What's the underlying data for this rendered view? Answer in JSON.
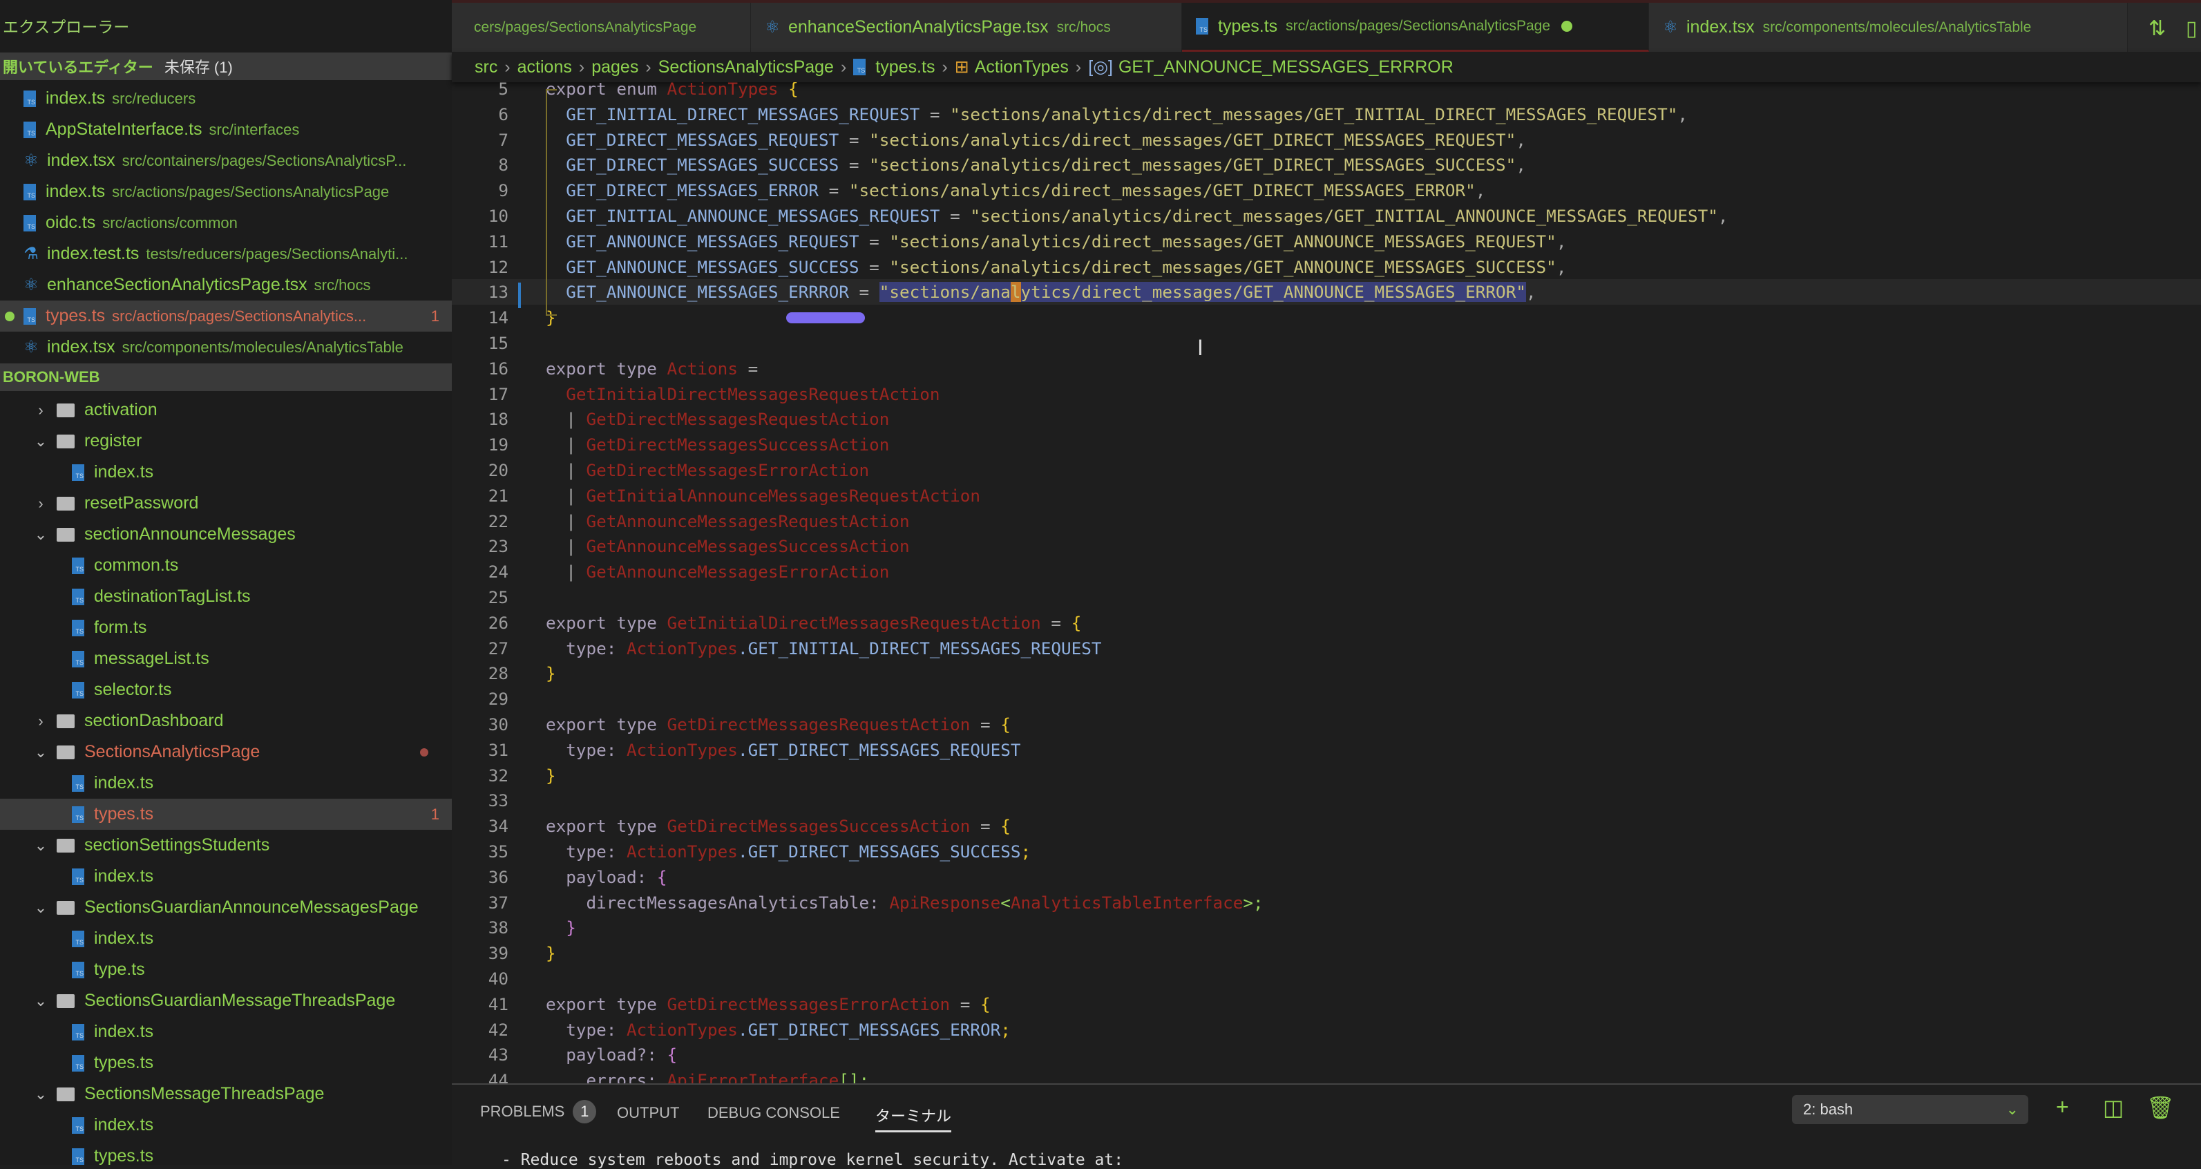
{
  "sidebar": {
    "title": "エクスプローラー",
    "open_editors": {
      "label": "開いているエディター",
      "unsaved": "未保存 (1)",
      "items": [
        {
          "name": "index.ts",
          "path": "src/reducers",
          "icon": "ts"
        },
        {
          "name": "AppStateInterface.ts",
          "path": "src/interfaces",
          "icon": "ts"
        },
        {
          "name": "index.tsx",
          "path": "src/containers/pages/SectionsAnalyticsP...",
          "icon": "react"
        },
        {
          "name": "index.ts",
          "path": "src/actions/pages/SectionsAnalyticsPage",
          "icon": "ts"
        },
        {
          "name": "oidc.ts",
          "path": "src/actions/common",
          "icon": "ts"
        },
        {
          "name": "index.test.ts",
          "path": "tests/reducers/pages/SectionsAnalyti...",
          "icon": "flask"
        },
        {
          "name": "enhanceSectionAnalyticsPage.tsx",
          "path": "src/hocs",
          "icon": "react"
        },
        {
          "name": "types.ts",
          "path": "src/actions/pages/SectionsAnalytics...",
          "icon": "ts",
          "badge": "1",
          "selected": true,
          "error": true,
          "unsaved": true
        },
        {
          "name": "index.tsx",
          "path": "src/components/molecules/AnalyticsTable",
          "icon": "react"
        }
      ]
    },
    "project": "BORON-WEB",
    "tree": [
      {
        "name": "activation",
        "type": "folder",
        "open": false
      },
      {
        "name": "register",
        "type": "folder",
        "open": true
      },
      {
        "name": "index.ts",
        "type": "file"
      },
      {
        "name": "resetPassword",
        "type": "folder",
        "open": false
      },
      {
        "name": "sectionAnnounceMessages",
        "type": "folder",
        "open": true
      },
      {
        "name": "common.ts",
        "type": "file"
      },
      {
        "name": "destinationTagList.ts",
        "type": "file"
      },
      {
        "name": "form.ts",
        "type": "file"
      },
      {
        "name": "messageList.ts",
        "type": "file"
      },
      {
        "name": "selector.ts",
        "type": "file"
      },
      {
        "name": "sectionDashboard",
        "type": "folder",
        "open": false
      },
      {
        "name": "SectionsAnalyticsPage",
        "type": "folder",
        "open": true,
        "error": true
      },
      {
        "name": "index.ts",
        "type": "file"
      },
      {
        "name": "types.ts",
        "type": "file",
        "selected": true,
        "error": true,
        "badge": "1"
      },
      {
        "name": "sectionSettingsStudents",
        "type": "folder",
        "open": true
      },
      {
        "name": "index.ts",
        "type": "file"
      },
      {
        "name": "SectionsGuardianAnnounceMessagesPage",
        "type": "folder",
        "open": true
      },
      {
        "name": "index.ts",
        "type": "file"
      },
      {
        "name": "type.ts",
        "type": "file"
      },
      {
        "name": "SectionsGuardianMessageThreadsPage",
        "type": "folder",
        "open": true
      },
      {
        "name": "index.ts",
        "type": "file"
      },
      {
        "name": "types.ts",
        "type": "file"
      },
      {
        "name": "SectionsMessageThreadsPage",
        "type": "folder",
        "open": true
      },
      {
        "name": "index.ts",
        "type": "file"
      },
      {
        "name": "types.ts",
        "type": "file"
      }
    ]
  },
  "tabs": [
    {
      "title": "",
      "desc": "cers/pages/SectionsAnalyticsPage",
      "icon": ""
    },
    {
      "title": "enhanceSectionAnalyticsPage.tsx",
      "desc": "src/hocs",
      "icon": "react"
    },
    {
      "title": "types.ts",
      "desc": "src/actions/pages/SectionsAnalyticsPage",
      "icon": "ts",
      "active": true,
      "dirty": true
    },
    {
      "title": "index.tsx",
      "desc": "src/components/molecules/AnalyticsTable",
      "icon": "react"
    }
  ],
  "breadcrumb": [
    "src",
    "actions",
    "pages",
    "SectionsAnalyticsPage",
    "types.ts",
    "ActionTypes",
    "GET_ANNOUNCE_MESSAGES_ERRROR"
  ],
  "editor": {
    "current_line": 13,
    "lines": [
      {
        "n": "5",
        "t": [
          [
            "export enum ",
            "kw"
          ],
          [
            "ActionTypes",
            "tn"
          ],
          [
            " {",
            "br"
          ]
        ]
      },
      {
        "n": "6",
        "t": [
          [
            "  GET_INITIAL_DIRECT_MESSAGES_REQUEST",
            "id"
          ],
          [
            " = ",
            "p"
          ],
          [
            "\"sections/analytics/direct_messages/GET_INITIAL_DIRECT_MESSAGES_REQUEST\"",
            "str"
          ],
          [
            ",",
            "p"
          ]
        ]
      },
      {
        "n": "7",
        "t": [
          [
            "  GET_DIRECT_MESSAGES_REQUEST",
            "id"
          ],
          [
            " = ",
            "p"
          ],
          [
            "\"sections/analytics/direct_messages/GET_DIRECT_MESSAGES_REQUEST\"",
            "str"
          ],
          [
            ",",
            "p"
          ]
        ]
      },
      {
        "n": "8",
        "t": [
          [
            "  GET_DIRECT_MESSAGES_SUCCESS",
            "id"
          ],
          [
            " = ",
            "p"
          ],
          [
            "\"sections/analytics/direct_messages/GET_DIRECT_MESSAGES_SUCCESS\"",
            "str"
          ],
          [
            ",",
            "p"
          ]
        ]
      },
      {
        "n": "9",
        "t": [
          [
            "  GET_DIRECT_MESSAGES_ERROR",
            "id"
          ],
          [
            " = ",
            "p"
          ],
          [
            "\"sections/analytics/direct_messages/GET_DIRECT_MESSAGES_ERROR\"",
            "str"
          ],
          [
            ",",
            "p"
          ]
        ]
      },
      {
        "n": "10",
        "t": [
          [
            "  GET_INITIAL_ANNOUNCE_MESSAGES_REQUEST",
            "id"
          ],
          [
            " = ",
            "p"
          ],
          [
            "\"sections/analytics/direct_messages/GET_INITIAL_ANNOUNCE_MESSAGES_REQUEST\"",
            "str"
          ],
          [
            ",",
            "p"
          ]
        ]
      },
      {
        "n": "11",
        "t": [
          [
            "  GET_ANNOUNCE_MESSAGES_REQUEST",
            "id"
          ],
          [
            " = ",
            "p"
          ],
          [
            "\"sections/analytics/direct_messages/GET_ANNOUNCE_MESSAGES_REQUEST\"",
            "str"
          ],
          [
            ",",
            "p"
          ]
        ]
      },
      {
        "n": "12",
        "t": [
          [
            "  GET_ANNOUNCE_MESSAGES_SUCCESS",
            "id"
          ],
          [
            " = ",
            "p"
          ],
          [
            "\"sections/analytics/direct_messages/GET_ANNOUNCE_MESSAGES_SUCCESS\"",
            "str"
          ],
          [
            ",",
            "p"
          ]
        ]
      },
      {
        "n": "13",
        "t": [
          [
            "  GET_ANNOUNCE_MESSAGES_ERRROR",
            "id"
          ],
          [
            " = ",
            "p"
          ],
          [
            "\"sections/ana",
            "str sel"
          ],
          [
            "l",
            "str sel cur"
          ],
          [
            "ytics/direct_messages/GET_ANNOUNCE_MESSAGES_ERROR\"",
            "str sel"
          ],
          [
            ",",
            "p"
          ]
        ]
      },
      {
        "n": "14",
        "t": [
          [
            "}",
            "br"
          ]
        ]
      },
      {
        "n": "15",
        "t": []
      },
      {
        "n": "16",
        "t": [
          [
            "export type ",
            "kw"
          ],
          [
            "Actions",
            "tn"
          ],
          [
            " =",
            "p"
          ]
        ]
      },
      {
        "n": "17",
        "t": [
          [
            "  GetInitialDirectMessagesRequestAction",
            "tn"
          ]
        ]
      },
      {
        "n": "18",
        "t": [
          [
            "  | ",
            "p"
          ],
          [
            "GetDirectMessagesRequestAction",
            "tn"
          ]
        ]
      },
      {
        "n": "19",
        "t": [
          [
            "  | ",
            "p"
          ],
          [
            "GetDirectMessagesSuccessAction",
            "tn"
          ]
        ]
      },
      {
        "n": "20",
        "t": [
          [
            "  | ",
            "p"
          ],
          [
            "GetDirectMessagesErrorAction",
            "tn"
          ]
        ]
      },
      {
        "n": "21",
        "t": [
          [
            "  | ",
            "p"
          ],
          [
            "GetInitialAnnounceMessagesRequestAction",
            "tn"
          ]
        ]
      },
      {
        "n": "22",
        "t": [
          [
            "  | ",
            "p"
          ],
          [
            "GetAnnounceMessagesRequestAction",
            "tn"
          ]
        ]
      },
      {
        "n": "23",
        "t": [
          [
            "  | ",
            "p"
          ],
          [
            "GetAnnounceMessagesSuccessAction",
            "tn"
          ]
        ]
      },
      {
        "n": "24",
        "t": [
          [
            "  | ",
            "p"
          ],
          [
            "GetAnnounceMessagesErrorAction",
            "tn"
          ]
        ]
      },
      {
        "n": "25",
        "t": []
      },
      {
        "n": "26",
        "t": [
          [
            "export type ",
            "kw"
          ],
          [
            "GetInitialDirectMessagesRequestAction",
            "tn"
          ],
          [
            " = ",
            "p"
          ],
          [
            "{",
            "br"
          ]
        ]
      },
      {
        "n": "27",
        "t": [
          [
            "  type: ",
            "kw"
          ],
          [
            "ActionTypes",
            "tn"
          ],
          [
            ".GET_INITIAL_DIRECT_MESSAGES_REQUEST",
            "id"
          ]
        ]
      },
      {
        "n": "28",
        "t": [
          [
            "}",
            "br"
          ]
        ]
      },
      {
        "n": "29",
        "t": []
      },
      {
        "n": "30",
        "t": [
          [
            "export type ",
            "kw"
          ],
          [
            "GetDirectMessagesRequestAction",
            "tn"
          ],
          [
            " = ",
            "p"
          ],
          [
            "{",
            "br"
          ]
        ]
      },
      {
        "n": "31",
        "t": [
          [
            "  type: ",
            "kw"
          ],
          [
            "ActionTypes",
            "tn"
          ],
          [
            ".GET_DIRECT_MESSAGES_REQUEST",
            "id"
          ]
        ]
      },
      {
        "n": "32",
        "t": [
          [
            "}",
            "br"
          ]
        ]
      },
      {
        "n": "33",
        "t": []
      },
      {
        "n": "34",
        "t": [
          [
            "export type ",
            "kw"
          ],
          [
            "GetDirectMessagesSuccessAction",
            "tn"
          ],
          [
            " = ",
            "p"
          ],
          [
            "{",
            "br"
          ]
        ]
      },
      {
        "n": "35",
        "t": [
          [
            "  type: ",
            "kw"
          ],
          [
            "ActionTypes",
            "tn"
          ],
          [
            ".GET_DIRECT_MESSAGES_SUCCESS",
            "id"
          ],
          [
            ";",
            "br"
          ]
        ]
      },
      {
        "n": "36",
        "t": [
          [
            "  payload: ",
            "kw"
          ],
          [
            "{",
            "pk"
          ]
        ]
      },
      {
        "n": "37",
        "t": [
          [
            "    directMessagesAnalyticsTable: ",
            "kw"
          ],
          [
            "ApiResponse",
            "tn"
          ],
          [
            "<",
            "gr"
          ],
          [
            "AnalyticsTableInterface",
            "tn"
          ],
          [
            ">;",
            "gr"
          ]
        ]
      },
      {
        "n": "38",
        "t": [
          [
            "  }",
            "pk"
          ]
        ]
      },
      {
        "n": "39",
        "t": [
          [
            "}",
            "br"
          ]
        ]
      },
      {
        "n": "40",
        "t": []
      },
      {
        "n": "41",
        "t": [
          [
            "export type ",
            "kw"
          ],
          [
            "GetDirectMessagesErrorAction",
            "tn"
          ],
          [
            " = ",
            "p"
          ],
          [
            "{",
            "br"
          ]
        ]
      },
      {
        "n": "42",
        "t": [
          [
            "  type: ",
            "kw"
          ],
          [
            "ActionTypes",
            "tn"
          ],
          [
            ".GET_DIRECT_MESSAGES_ERROR",
            "id"
          ],
          [
            ";",
            "br"
          ]
        ]
      },
      {
        "n": "43",
        "t": [
          [
            "  payload?: ",
            "kw"
          ],
          [
            "{",
            "pk"
          ]
        ]
      },
      {
        "n": "44",
        "t": [
          [
            "    errors: ",
            "kw"
          ],
          [
            "ApiErrorInterface",
            "tn"
          ],
          [
            "[];",
            "gr"
          ]
        ]
      }
    ]
  },
  "panel": {
    "tabs": [
      "PROBLEMS",
      "OUTPUT",
      "DEBUG CONSOLE",
      "ターミナル"
    ],
    "problems_count": "1",
    "terminal_select": "2: bash",
    "terminal_text": "- Reduce system reboots and improve kernel security. Activate at:"
  },
  "colors": {
    "accent": "#8fd24f",
    "error": "#d86a52",
    "selection": "#3a3f7a",
    "background": "#1e1e1e"
  }
}
